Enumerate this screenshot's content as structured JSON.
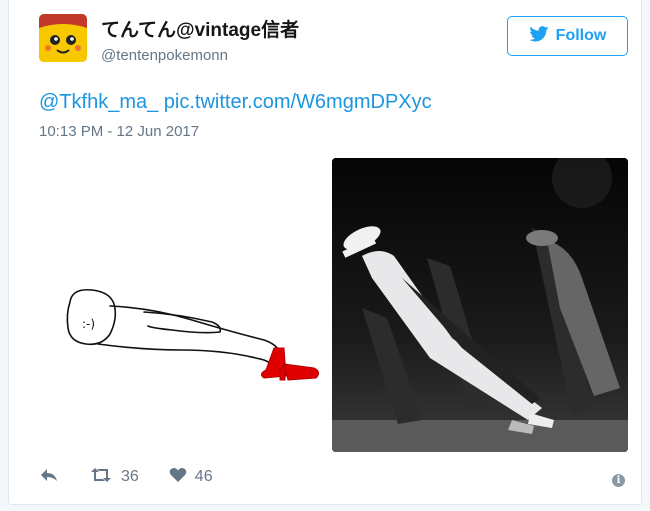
{
  "tweet": {
    "display_name": "てんてん@vintage信者",
    "handle": "@tentenpokemonn",
    "follow_label": "Follow",
    "text": {
      "mention": "@Tkfhk_ma_",
      "link": "pic.twitter.com/W6mgmDPXyc"
    },
    "timestamp": "10:13 PM - 12 Jun 2017",
    "retweet_count": "36",
    "like_count": "46"
  },
  "icons": {
    "follow": "twitter-bird-icon",
    "reply": "reply-icon",
    "retweet": "retweet-icon",
    "like": "heart-icon",
    "info": "info-icon"
  },
  "colors": {
    "accent": "#1da1f2",
    "link": "#1b95e0",
    "muted": "#657786",
    "shoe": "#e00000"
  }
}
